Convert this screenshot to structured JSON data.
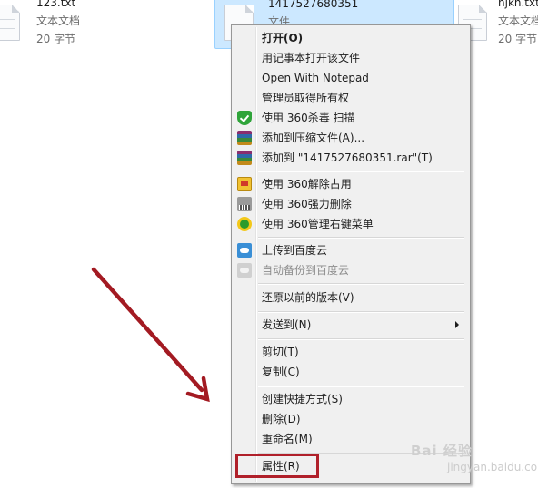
{
  "files": [
    {
      "name": "123.txt",
      "type": "文本文档",
      "size": "20 字节"
    },
    {
      "name": "1417527680351",
      "type": "文件"
    },
    {
      "name": "hjkh.txt",
      "type": "文本文档",
      "size": "20 字节"
    }
  ],
  "menu": {
    "items": [
      {
        "label": "打开(O)"
      },
      {
        "label": "用记事本打开该文件"
      },
      {
        "label": "Open With Notepad"
      },
      {
        "label": "管理员取得所有权"
      },
      {
        "label": "使用 360杀毒 扫描",
        "icon": "shield-icon"
      },
      {
        "label": "添加到压缩文件(A)...",
        "icon": "archive-icon"
      },
      {
        "label": "添加到 \"1417527680351.rar\"(T)",
        "icon": "archive-icon"
      },
      {
        "label": "使用 360解除占用",
        "icon": "unlock-icon"
      },
      {
        "label": "使用 360强力删除",
        "icon": "shredder-icon"
      },
      {
        "label": "使用 360管理右键菜单",
        "icon": "360-icon"
      },
      {
        "label": "上传到百度云",
        "icon": "cloud-upload-icon"
      },
      {
        "label": "自动备份到百度云",
        "icon": "cloud-backup-icon"
      },
      {
        "label": "还原以前的版本(V)"
      },
      {
        "label": "发送到(N)"
      },
      {
        "label": "剪切(T)"
      },
      {
        "label": "复制(C)"
      },
      {
        "label": "创建快捷方式(S)"
      },
      {
        "label": "删除(D)"
      },
      {
        "label": "重命名(M)"
      },
      {
        "label": "属性(R)"
      }
    ]
  },
  "annotation": {
    "arrow_color": "#a31a22",
    "highlight_color": "#b0202a"
  },
  "watermark": {
    "text": "Bai 经验",
    "sub": "jingyan.baidu.com"
  }
}
